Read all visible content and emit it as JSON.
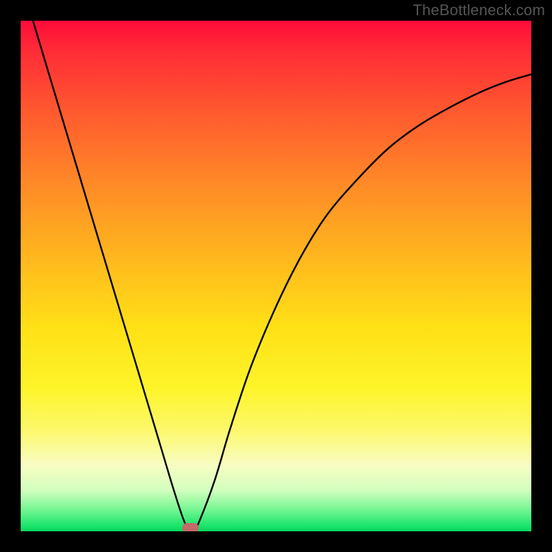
{
  "watermark": "TheBottleneck.com",
  "chart_data": {
    "type": "line",
    "title": "",
    "xlabel": "",
    "ylabel": "",
    "xlim": [
      0,
      100
    ],
    "ylim": [
      0,
      100
    ],
    "grid": false,
    "series": [
      {
        "name": "bottleneck-curve",
        "x": [
          0,
          3,
          6,
          9,
          12,
          15,
          18,
          21,
          24,
          27,
          30,
          32,
          33,
          34,
          35,
          38,
          41,
          45,
          50,
          55,
          60,
          66,
          72,
          78,
          84,
          90,
          95,
          100
        ],
        "y": [
          108,
          98,
          88,
          78,
          68,
          58,
          48,
          38,
          28,
          18,
          8,
          2,
          0.5,
          0.5,
          2,
          10,
          20,
          32,
          44,
          54,
          62,
          69,
          75,
          79.5,
          83,
          86,
          88,
          89.5
        ]
      }
    ],
    "marker": {
      "x": 33.3,
      "y": 0.7
    },
    "palette": {
      "gradient_top": "#ff0b3a",
      "gradient_bottom": "#09d65e",
      "curve_color": "#000000",
      "marker_color": "#c46a68",
      "frame_color": "#000000"
    }
  }
}
